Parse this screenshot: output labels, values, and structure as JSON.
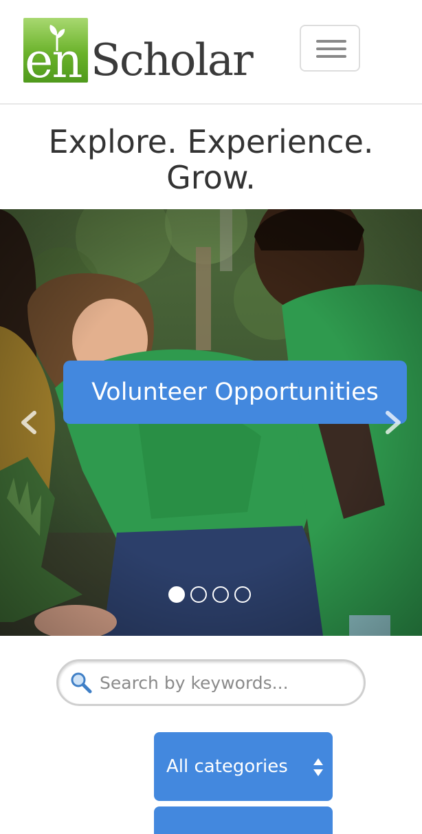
{
  "header": {
    "logo": {
      "part1": "en",
      "part2": "Scholar"
    },
    "menu_toggle_icon": "hamburger-icon"
  },
  "hero": {
    "headline": "Explore. Experience. Grow."
  },
  "carousel": {
    "caption": "Volunteer Opportunities",
    "slide_count": 4,
    "active_slide": 1,
    "prev_icon": "chevron-left-icon",
    "next_icon": "chevron-right-icon"
  },
  "search": {
    "placeholder": "Search by keywords...",
    "value": "",
    "icon": "search-icon"
  },
  "filters": {
    "category_selected": "All categories",
    "category_icon": "select-arrows-icon"
  },
  "colors": {
    "accent_blue": "#4388de",
    "logo_green": "#6ab22a",
    "text_dark": "#333333"
  }
}
